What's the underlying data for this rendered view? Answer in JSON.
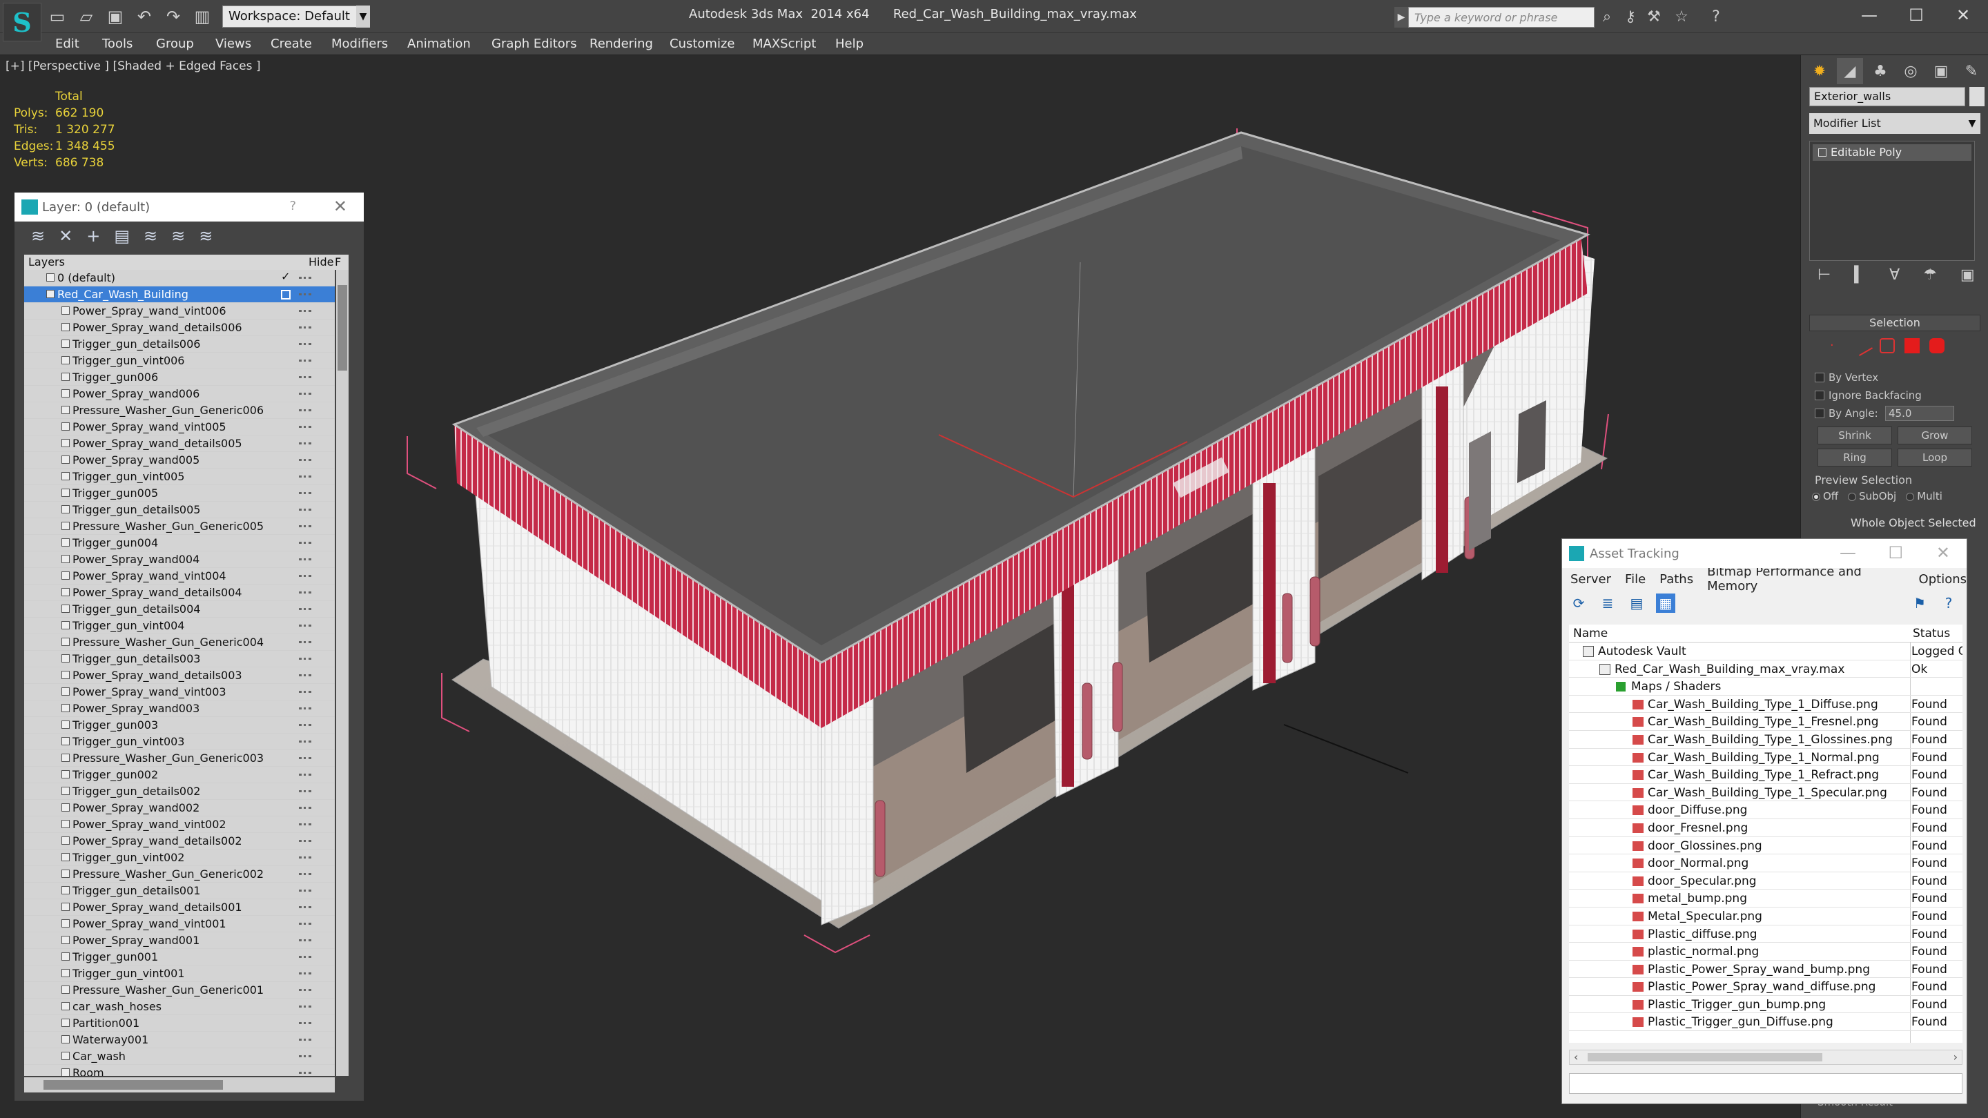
{
  "app": {
    "title": "Autodesk 3ds Max  2014 x64      Red_Car_Wash_Building_max_vray.max",
    "workspace": "Workspace: Default",
    "search_placeholder": "Type a keyword or phrase",
    "logo_letter": "S",
    "quick_access_icons": [
      "new-icon",
      "open-icon",
      "save-icon",
      "undo-icon",
      "redo-icon",
      "project-icon"
    ],
    "title_icons": [
      "binoculars-icon",
      "key-icon",
      "star-icon",
      "help-icon"
    ]
  },
  "menu": [
    "Edit",
    "Tools",
    "Group",
    "Views",
    "Create",
    "Modifiers",
    "Animation",
    "Graph Editors",
    "Rendering",
    "Customize",
    "MAXScript",
    "Help"
  ],
  "viewport": {
    "label": "[+] [Perspective ] [Shaded + Edged Faces ]",
    "stats_header": "Total",
    "stats": [
      {
        "k": "Polys:",
        "v": "662 190"
      },
      {
        "k": "Tris:",
        "v": "1 320 277"
      },
      {
        "k": "Edges:",
        "v": "1 348 455"
      },
      {
        "k": "Verts:",
        "v": "686 738"
      }
    ]
  },
  "layer_panel": {
    "title": "Layer: 0 (default)",
    "help": "?",
    "close": "✕",
    "toolbar_icons": [
      "new-layer-icon",
      "delete-layer-icon",
      "add-to-layer-icon",
      "select-objects-icon",
      "highlight-layer-icon",
      "hide-all-icon",
      "freeze-all-icon"
    ],
    "columns": {
      "layers": "Layers",
      "hide": "Hide",
      "freeze": "F"
    },
    "rows": [
      {
        "name": "0 (default)",
        "top": true,
        "check": "✓"
      },
      {
        "name": "Red_Car_Wash_Building",
        "top": true,
        "selected": true
      },
      {
        "name": "Power_Spray_wand_vint006"
      },
      {
        "name": "Power_Spray_wand_details006"
      },
      {
        "name": "Trigger_gun_details006"
      },
      {
        "name": "Trigger_gun_vint006"
      },
      {
        "name": "Trigger_gun006"
      },
      {
        "name": "Power_Spray_wand006"
      },
      {
        "name": "Pressure_Washer_Gun_Generic006"
      },
      {
        "name": "Power_Spray_wand_vint005"
      },
      {
        "name": "Power_Spray_wand_details005"
      },
      {
        "name": "Power_Spray_wand005"
      },
      {
        "name": "Trigger_gun_vint005"
      },
      {
        "name": "Trigger_gun005"
      },
      {
        "name": "Trigger_gun_details005"
      },
      {
        "name": "Pressure_Washer_Gun_Generic005"
      },
      {
        "name": "Trigger_gun004"
      },
      {
        "name": "Power_Spray_wand004"
      },
      {
        "name": "Power_Spray_wand_vint004"
      },
      {
        "name": "Power_Spray_wand_details004"
      },
      {
        "name": "Trigger_gun_details004"
      },
      {
        "name": "Trigger_gun_vint004"
      },
      {
        "name": "Pressure_Washer_Gun_Generic004"
      },
      {
        "name": "Trigger_gun_details003"
      },
      {
        "name": "Power_Spray_wand_details003"
      },
      {
        "name": "Power_Spray_wand_vint003"
      },
      {
        "name": "Power_Spray_wand003"
      },
      {
        "name": "Trigger_gun003"
      },
      {
        "name": "Trigger_gun_vint003"
      },
      {
        "name": "Pressure_Washer_Gun_Generic003"
      },
      {
        "name": "Trigger_gun002"
      },
      {
        "name": "Trigger_gun_details002"
      },
      {
        "name": "Power_Spray_wand002"
      },
      {
        "name": "Power_Spray_wand_vint002"
      },
      {
        "name": "Power_Spray_wand_details002"
      },
      {
        "name": "Trigger_gun_vint002"
      },
      {
        "name": "Pressure_Washer_Gun_Generic002"
      },
      {
        "name": "Trigger_gun_details001"
      },
      {
        "name": "Power_Spray_wand_details001"
      },
      {
        "name": "Power_Spray_wand_vint001"
      },
      {
        "name": "Power_Spray_wand001"
      },
      {
        "name": "Trigger_gun001"
      },
      {
        "name": "Trigger_gun_vint001"
      },
      {
        "name": "Pressure_Washer_Gun_Generic001"
      },
      {
        "name": "car_wash_hoses"
      },
      {
        "name": "Partition001"
      },
      {
        "name": "Waterway001"
      },
      {
        "name": "Car_wash"
      },
      {
        "name": "Room"
      }
    ]
  },
  "command_panel": {
    "tab_icons": [
      "create-icon",
      "modify-icon",
      "hierarchy-icon",
      "motion-icon",
      "display-icon",
      "utilities-icon"
    ],
    "object_name": "Exterior_walls",
    "modifier_list": "Modifier List",
    "stack_item": "Editable Poly",
    "stack_tool_icons": [
      "pin-stack-icon",
      "show-end-result-icon",
      "make-unique-icon",
      "remove-modifier-icon",
      "configure-sets-icon"
    ],
    "selection_title": "Selection",
    "subobject_icons": [
      "vertex-icon",
      "edge-icon",
      "border-icon",
      "polygon-icon",
      "element-icon"
    ],
    "by_vertex": "By Vertex",
    "ignore_backfacing": "Ignore Backfacing",
    "by_angle": "By Angle:",
    "angle_value": "45.0",
    "shrink": "Shrink",
    "grow": "Grow",
    "ring": "Ring",
    "loop": "Loop",
    "preview_selection": "Preview Selection",
    "preview_off": "Off",
    "preview_subobj": "SubObj",
    "preview_multi": "Multi",
    "whole_object": "Whole Object Selected",
    "smooth_result": "Smooth Result"
  },
  "asset_tracking": {
    "title": "Asset Tracking",
    "menu": [
      "Server",
      "File",
      "Paths",
      "Bitmap Performance and Memory",
      "Options"
    ],
    "tool_icons": [
      "refresh-icon",
      "list-view-icon",
      "detail-view-icon",
      "table-view-icon"
    ],
    "col_name": "Name",
    "col_status": "Status",
    "rows": [
      {
        "name": "Autodesk Vault",
        "status": "Logged O",
        "indent": 0,
        "kind": "vault"
      },
      {
        "name": "Red_Car_Wash_Building_max_vray.max",
        "status": "Ok",
        "indent": 1,
        "kind": "file"
      },
      {
        "name": "Maps / Shaders",
        "status": "",
        "indent": 2,
        "kind": "folder"
      },
      {
        "name": "Car_Wash_Building_Type_1_Diffuse.png",
        "status": "Found",
        "indent": 3,
        "kind": "png"
      },
      {
        "name": "Car_Wash_Building_Type_1_Fresnel.png",
        "status": "Found",
        "indent": 3,
        "kind": "png"
      },
      {
        "name": "Car_Wash_Building_Type_1_Glossines.png",
        "status": "Found",
        "indent": 3,
        "kind": "png"
      },
      {
        "name": "Car_Wash_Building_Type_1_Normal.png",
        "status": "Found",
        "indent": 3,
        "kind": "png"
      },
      {
        "name": "Car_Wash_Building_Type_1_Refract.png",
        "status": "Found",
        "indent": 3,
        "kind": "png"
      },
      {
        "name": "Car_Wash_Building_Type_1_Specular.png",
        "status": "Found",
        "indent": 3,
        "kind": "png"
      },
      {
        "name": "door_Diffuse.png",
        "status": "Found",
        "indent": 3,
        "kind": "png"
      },
      {
        "name": "door_Fresnel.png",
        "status": "Found",
        "indent": 3,
        "kind": "png"
      },
      {
        "name": "door_Glossines.png",
        "status": "Found",
        "indent": 3,
        "kind": "png"
      },
      {
        "name": "door_Normal.png",
        "status": "Found",
        "indent": 3,
        "kind": "png"
      },
      {
        "name": "door_Specular.png",
        "status": "Found",
        "indent": 3,
        "kind": "png"
      },
      {
        "name": "metal_bump.png",
        "status": "Found",
        "indent": 3,
        "kind": "png"
      },
      {
        "name": "Metal_Specular.png",
        "status": "Found",
        "indent": 3,
        "kind": "png"
      },
      {
        "name": "Plastic_diffuse.png",
        "status": "Found",
        "indent": 3,
        "kind": "png"
      },
      {
        "name": "plastic_normal.png",
        "status": "Found",
        "indent": 3,
        "kind": "png"
      },
      {
        "name": "Plastic_Power_Spray_wand_bump.png",
        "status": "Found",
        "indent": 3,
        "kind": "png"
      },
      {
        "name": "Plastic_Power_Spray_wand_diffuse.png",
        "status": "Found",
        "indent": 3,
        "kind": "png"
      },
      {
        "name": "Plastic_Trigger_gun_bump.png",
        "status": "Found",
        "indent": 3,
        "kind": "png"
      },
      {
        "name": "Plastic_Trigger_gun_Diffuse.png",
        "status": "Found",
        "indent": 3,
        "kind": "png"
      }
    ]
  },
  "colors": {
    "accent": "#3b7fd6",
    "stats": "#e8d23a",
    "trim": "#d0304e",
    "logo": "#1ec0c9"
  }
}
